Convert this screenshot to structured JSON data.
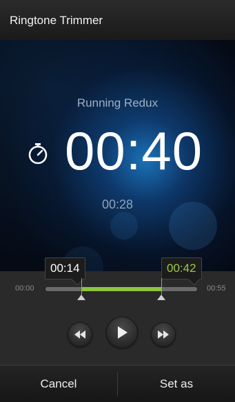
{
  "app": {
    "title": "Ringtone Trimmer"
  },
  "player": {
    "song_title": "Running Redux",
    "duration_display": "00:40",
    "current_position": "00:28"
  },
  "trim": {
    "start_label": "00:14",
    "end_label": "00:42",
    "track_start": "00:00",
    "track_end": "00:55",
    "selection_color": "#8cc63f",
    "end_label_color": "#9ccc45"
  },
  "controls": {
    "rewind_icon": "rewind-icon",
    "play_icon": "play-icon",
    "forward_icon": "fast-forward-icon"
  },
  "actions": {
    "cancel_label": "Cancel",
    "set_as_label": "Set as"
  }
}
